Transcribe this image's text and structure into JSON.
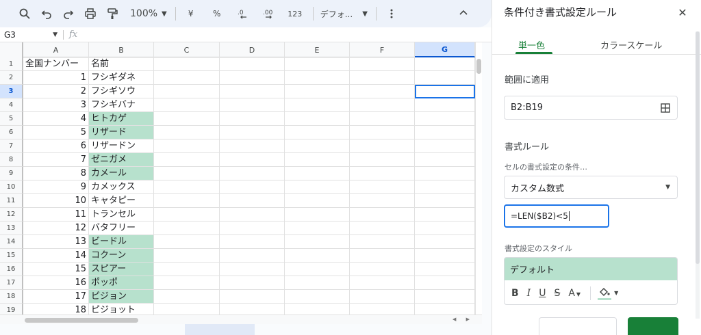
{
  "toolbar": {
    "zoom": "100%",
    "currency": "¥",
    "percent": "%",
    "format_123": "123",
    "font": "デフォ..."
  },
  "formula_bar": {
    "name_box": "G3",
    "fx": "fx"
  },
  "grid": {
    "columns": [
      "A",
      "B",
      "C",
      "D",
      "E",
      "F",
      "G"
    ],
    "selected_column": "G",
    "selected_row": "3",
    "rows": [
      {
        "n": "1",
        "a": "全国ナンバー",
        "b": "名前",
        "hl": false
      },
      {
        "n": "2",
        "a": "1",
        "b": "フシギダネ",
        "hl": false
      },
      {
        "n": "3",
        "a": "2",
        "b": "フシギソウ",
        "hl": false
      },
      {
        "n": "4",
        "a": "3",
        "b": "フシギバナ",
        "hl": false
      },
      {
        "n": "5",
        "a": "4",
        "b": "ヒトカゲ",
        "hl": true
      },
      {
        "n": "6",
        "a": "5",
        "b": "リザード",
        "hl": true
      },
      {
        "n": "7",
        "a": "6",
        "b": "リザードン",
        "hl": false
      },
      {
        "n": "8",
        "a": "7",
        "b": "ゼニガメ",
        "hl": true
      },
      {
        "n": "9",
        "a": "8",
        "b": "カメール",
        "hl": true
      },
      {
        "n": "10",
        "a": "9",
        "b": "カメックス",
        "hl": false
      },
      {
        "n": "11",
        "a": "10",
        "b": "キャタピー",
        "hl": false
      },
      {
        "n": "12",
        "a": "11",
        "b": "トランセル",
        "hl": false
      },
      {
        "n": "13",
        "a": "12",
        "b": "バタフリー",
        "hl": false
      },
      {
        "n": "14",
        "a": "13",
        "b": "ビードル",
        "hl": true
      },
      {
        "n": "15",
        "a": "14",
        "b": "コクーン",
        "hl": true
      },
      {
        "n": "16",
        "a": "15",
        "b": "スピアー",
        "hl": true
      },
      {
        "n": "17",
        "a": "16",
        "b": "ポッポ",
        "hl": true
      },
      {
        "n": "18",
        "a": "17",
        "b": "ピジョン",
        "hl": true
      },
      {
        "n": "19",
        "a": "18",
        "b": "ピジョット",
        "hl": false
      }
    ],
    "highlight_color": "#b7e1cd"
  },
  "panel": {
    "title": "条件付き書式設定ルール",
    "tabs": [
      {
        "label": "単一色"
      },
      {
        "label": "カラースケール"
      }
    ],
    "range_label": "範囲に適用",
    "range_value": "B2:B19",
    "rules_label": "書式ルール",
    "condition_label": "セルの書式設定の条件…",
    "condition_value": "カスタム数式",
    "formula_value": "=LEN($B2)<5",
    "style_label": "書式設定のスタイル",
    "style_preview": "デフォルト",
    "style_tools": {
      "bold": "B",
      "italic": "I",
      "underline": "U",
      "strike": "S",
      "text_color": "A"
    },
    "accent_color": "#188038"
  }
}
